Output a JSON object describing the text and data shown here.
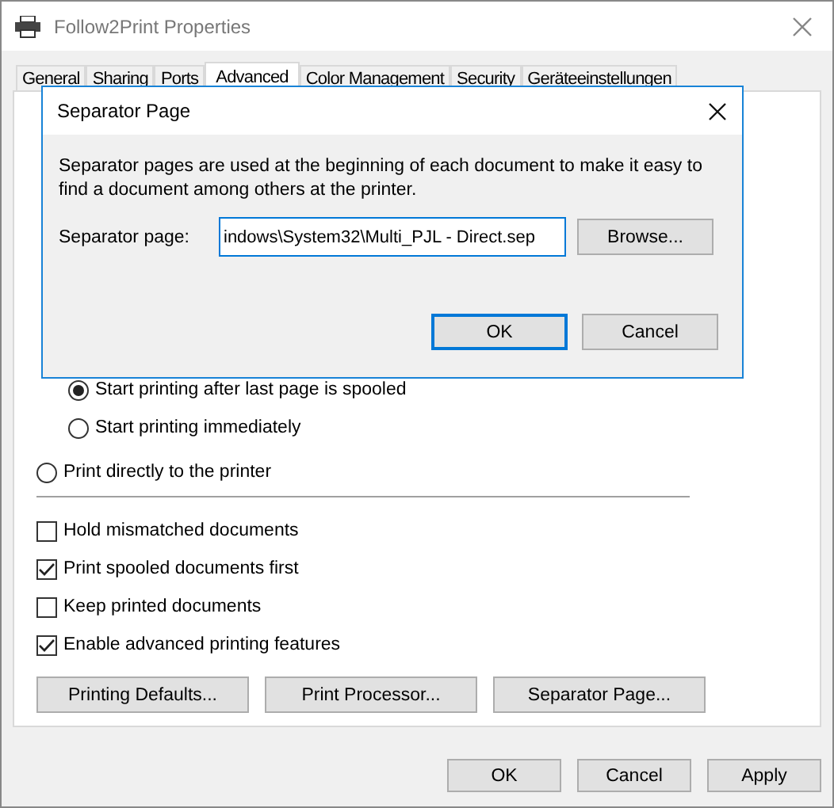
{
  "window": {
    "title": "Follow2Print Properties"
  },
  "tabs": [
    {
      "label": "General",
      "selected": false
    },
    {
      "label": "Sharing",
      "selected": false
    },
    {
      "label": "Ports",
      "selected": false
    },
    {
      "label": "Advanced",
      "selected": true
    },
    {
      "label": "Color Management",
      "selected": false
    },
    {
      "label": "Security",
      "selected": false
    },
    {
      "label": "Geräteeinstellungen",
      "selected": false
    }
  ],
  "spool_options": [
    {
      "label": "Start printing after last page is spooled",
      "selected": true
    },
    {
      "label": "Start printing immediately",
      "selected": false
    }
  ],
  "direct_option": {
    "label": "Print directly to the printer",
    "selected": false
  },
  "checkboxes": [
    {
      "label": "Hold mismatched documents",
      "checked": false
    },
    {
      "label": "Print spooled documents first",
      "checked": true
    },
    {
      "label": "Keep printed documents",
      "checked": false
    },
    {
      "label": "Enable advanced printing features",
      "checked": true
    }
  ],
  "panel_buttons": [
    "Printing Defaults...",
    "Print Processor...",
    "Separator Page..."
  ],
  "buttons": [
    "OK",
    "Cancel",
    "Apply"
  ],
  "dialog": {
    "title": "Separator Page",
    "description": "Separator pages are used at the beginning of each document to make it easy to find a document among others at the printer.",
    "field_label": "Separator page:",
    "field_value": "indows\\System32\\Multi_PJL - Direct.sep",
    "browse_button": "Browse...",
    "buttons": [
      "OK",
      "Cancel"
    ]
  }
}
